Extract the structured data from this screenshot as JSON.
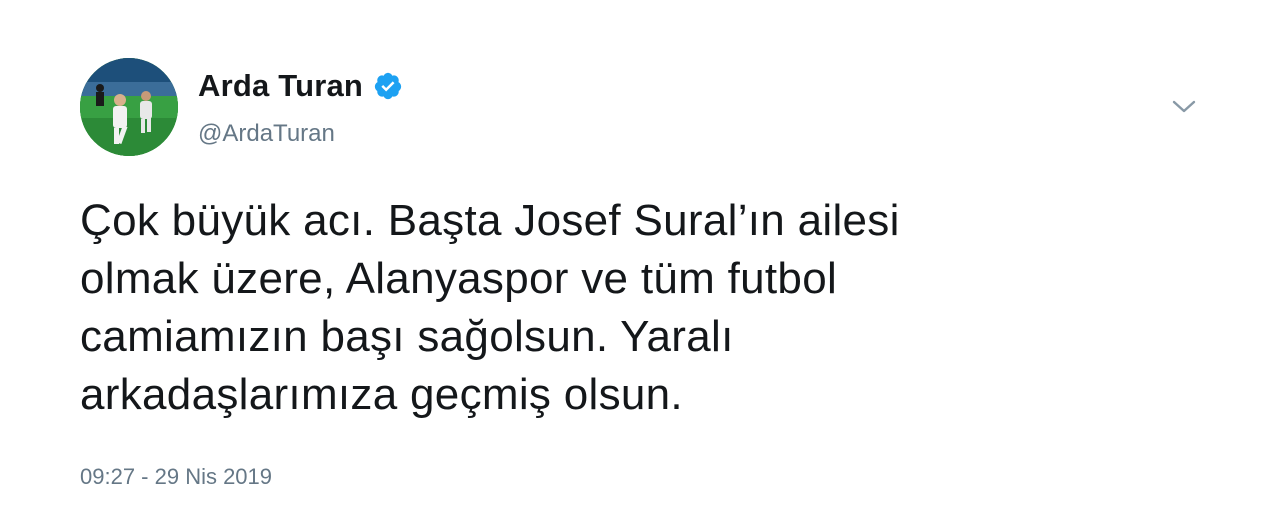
{
  "author": {
    "display_name": "Arda Turan",
    "handle": "@ArdaTuran",
    "verified": true
  },
  "icons": {
    "verified": "verified-badge-icon",
    "menu": "chevron-down-icon"
  },
  "tweet": {
    "text": "Çok büyük acı. Başta Josef Sural’ın ailesi\nolmak üzere, Alanyaspor ve tüm futbol\ncamiamızın başı sağolsun. Yaralı\narkadaşlarımıza geçmiş olsun.",
    "timestamp": "09:27 - 29 Nis 2019"
  },
  "colors": {
    "verified_blue": "#1da1f2",
    "text_primary": "#14171a",
    "text_secondary": "#657786"
  }
}
